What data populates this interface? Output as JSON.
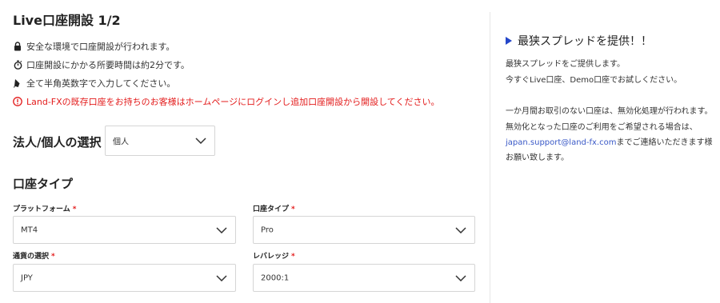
{
  "page": {
    "title": "Live口座開設 1/2"
  },
  "notices": [
    {
      "icon": "lock-icon",
      "text": "安全な環境で口座開設が行われます。"
    },
    {
      "icon": "stopwatch-icon",
      "text": "口座開設にかかる所要時間は約2分です。"
    },
    {
      "icon": "pen-icon",
      "text": "全て半角英数字で入力してください。"
    },
    {
      "icon": "warning-circle-icon",
      "text": "Land-FXの既存口座をお持ちのお客様はホームページにログインし追加口座開設から開設してください。",
      "color": "#e31b1b"
    }
  ],
  "entity": {
    "label": "法人/個人の選択",
    "value": "個人"
  },
  "account_section": {
    "title": "口座タイプ",
    "required_mark": "*",
    "platform": {
      "label": "プラットフォーム",
      "value": "MT4"
    },
    "account_type": {
      "label": "口座タイプ",
      "value": "Pro"
    },
    "currency": {
      "label": "通貨の選択",
      "value": "JPY"
    },
    "leverage": {
      "label": "レバレッジ",
      "value": "2000:1"
    }
  },
  "sidebar": {
    "title": "最狭スプレッドを提供！！",
    "line1": "最狭スプレッドをご提供します。",
    "line2": "今すぐLive口座、Demo口座でお試しください。",
    "line3": "一か月間お取引のない口座は、無効化処理が行われます。",
    "line4": "無効化となった口座のご利用をご希望される場合は、",
    "email": "japan.support@land-fx.com",
    "line5_suffix": "までご連絡いただきます様",
    "line6": "お願い致します。"
  },
  "colors": {
    "accent": "#2446c9",
    "required": "#e31b1b",
    "link": "#3a59c7",
    "border": "#d5d5d5"
  }
}
